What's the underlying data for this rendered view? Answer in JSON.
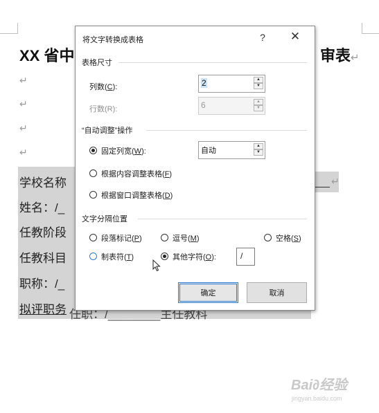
{
  "document": {
    "title_left": "XX 省中",
    "title_right": "审表",
    "lines": [
      "学校名称",
      "姓名：/_",
      "任教阶段",
      "任教科目",
      "职称：/_",
      "拟评职务"
    ],
    "last_line_rest": "任职：/________主任教科"
  },
  "dialog": {
    "title": "将文字转换成表格",
    "help": "?",
    "close": "✕",
    "size_group": "表格尺寸",
    "columns_label": "列数(",
    "columns_key": "C",
    "columns_label_end": "):",
    "columns_value": "2",
    "rows_label": "行数(R):",
    "rows_value": "6",
    "autofit_group": "“自动调整”操作",
    "fixed_width_label": "固定列宽(",
    "fixed_width_key": "W",
    "fixed_width_end": "):",
    "fixed_width_value": "自动",
    "fit_content_label": "根据内容调整表格(",
    "fit_content_key": "F",
    "fit_content_end": ")",
    "fit_window_label": "根据窗口调整表格(",
    "fit_window_key": "D",
    "fit_window_end": ")",
    "separator_group": "文字分隔位置",
    "sep_paragraph": "段落标记(",
    "sep_paragraph_key": "P",
    "sep_comma": "逗号(",
    "sep_comma_key": "M",
    "sep_space": "空格(",
    "sep_space_key": "S",
    "sep_tab": "制表符(",
    "sep_tab_key": "T",
    "sep_other": "其他字符(",
    "sep_other_key": "O",
    "sep_other_end": "):",
    "other_char_value": "/",
    "ok_label": "确定",
    "cancel_label": "取消"
  },
  "watermark": {
    "brand": "Bai∂经验",
    "url": "jingyan.baidu.com"
  }
}
